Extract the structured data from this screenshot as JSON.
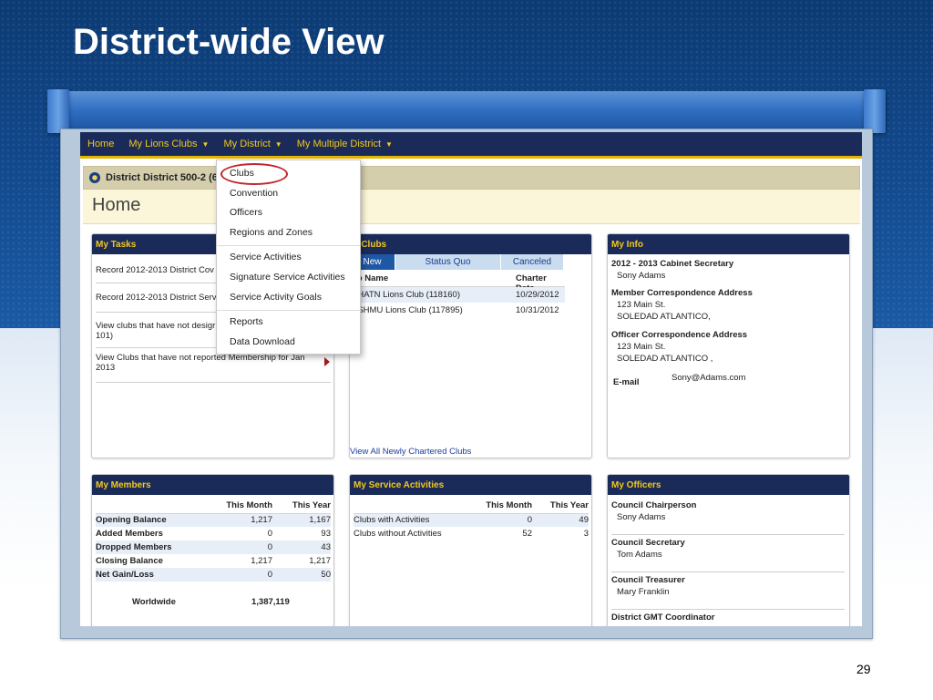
{
  "slide": {
    "title": "District-wide View",
    "page_number": "29"
  },
  "nav": {
    "items": [
      {
        "label": "Home",
        "caret": false
      },
      {
        "label": "My Lions Clubs",
        "caret": true
      },
      {
        "label": "My District",
        "caret": true
      },
      {
        "label": "My Multiple District",
        "caret": true
      }
    ]
  },
  "district_header": {
    "title": "District District 500-2 (6"
  },
  "home": {
    "title": "Home"
  },
  "dropdown": {
    "items": [
      "Clubs",
      "Convention",
      "Officers",
      "Regions and Zones",
      "Service Activities",
      "Signature Service Activities",
      "Service Activity Goals",
      "Reports",
      "Data Download"
    ]
  },
  "tasks": {
    "title": "My Tasks",
    "items": [
      "Record 2012-2013 District Cov",
      "Record 2012-2013 District Serv",
      "View clubs that have not desigr officers (PU-101)",
      "View Clubs that have not reported Membership for Jan 2013"
    ]
  },
  "clubs": {
    "title": "y Clubs",
    "tabs": [
      "New",
      "Status Quo",
      "Canceled"
    ],
    "columns": [
      "ub Name",
      "Charter Date"
    ],
    "rows": [
      {
        "name": "AHATN Lions Club (118160)",
        "date": "10/29/2012"
      },
      {
        "name": "ASHMU Lions Club (117895)",
        "date": "10/31/2012"
      }
    ],
    "link": "View All Newly Chartered Clubs"
  },
  "info": {
    "title": "My Info",
    "sections": [
      {
        "label": "2012 - 2013 Cabinet Secretary",
        "lines": [
          "Sony Adams"
        ]
      },
      {
        "label": "Member Correspondence Address",
        "lines": [
          "123 Main St.",
          "SOLEDAD ATLANTICO,"
        ]
      },
      {
        "label": "Officer Correspondence Address",
        "lines": [
          "123 Main St.",
          "SOLEDAD ATLANTICO ,"
        ]
      }
    ],
    "email_label": "E-mail",
    "email_value": "Sony@Adams.com"
  },
  "members": {
    "title": "My Members",
    "columns": [
      "This Month",
      "This Year"
    ],
    "rows": [
      {
        "label": "Opening Balance",
        "month": "1,217",
        "year": "1,167"
      },
      {
        "label": "Added Members",
        "month": "0",
        "year": "93"
      },
      {
        "label": "Dropped Members",
        "month": "0",
        "year": "43"
      },
      {
        "label": "Closing Balance",
        "month": "1,217",
        "year": "1,217"
      },
      {
        "label": "Net Gain/Loss",
        "month": "0",
        "year": "50"
      }
    ],
    "worldwide_label": "Worldwide",
    "worldwide_value": "1,387,119"
  },
  "service": {
    "title": "My Service Activities",
    "columns": [
      "This Month",
      "This Year"
    ],
    "rows": [
      {
        "label": "Clubs with Activities",
        "month": "0",
        "year": "49"
      },
      {
        "label": "Clubs without Activities",
        "month": "52",
        "year": "3"
      }
    ]
  },
  "officers": {
    "title": "My Officers",
    "items": [
      {
        "role": "Council Chairperson",
        "name": "Sony Adams"
      },
      {
        "role": "Council Secretary",
        "name": "Tom Adams"
      },
      {
        "role": "Council Treasurer",
        "name": "Mary Franklin"
      },
      {
        "role": "District GMT Coordinator",
        "name": ""
      }
    ]
  },
  "colors": {
    "nav_bg": "#1b2b59",
    "nav_text": "#f3c81a",
    "nav_underline": "#e4b400",
    "slide_blue": "#11478a",
    "highlight_circle": "#c0262b"
  }
}
